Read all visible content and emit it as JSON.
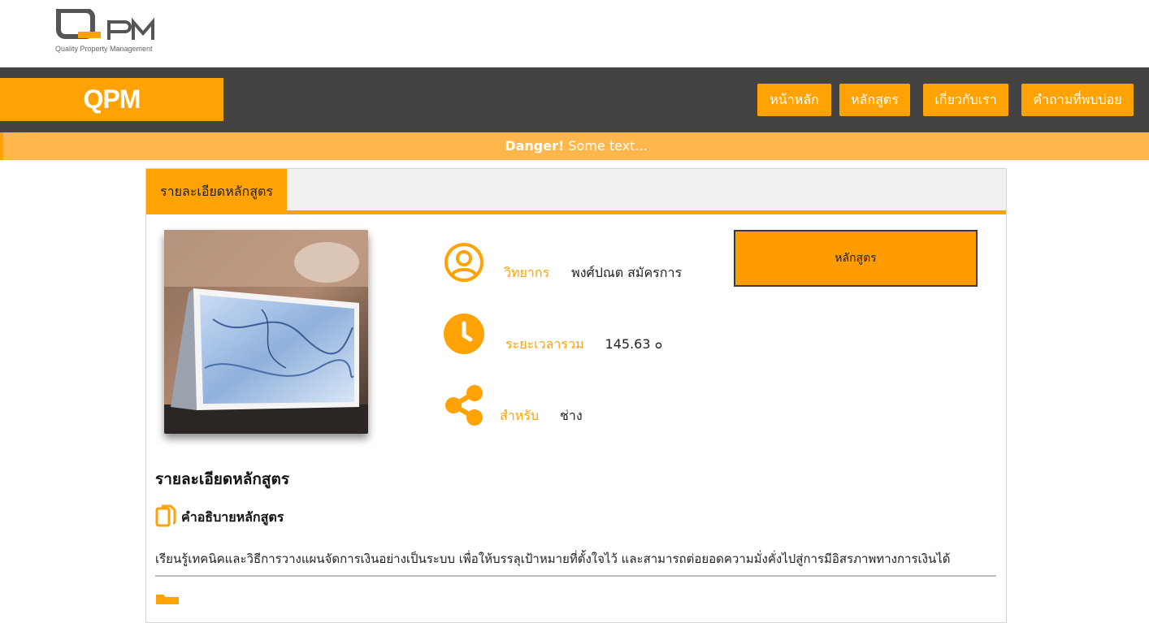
{
  "logo": {
    "letters": "QPM",
    "tagline": "Quality Property Management"
  },
  "navbar": {
    "brand": "QPM",
    "items": [
      {
        "label": "หน้าหลัก"
      },
      {
        "label": "หลักสูตร"
      },
      {
        "label": "เกี่ยวกับเรา"
      },
      {
        "label": "คำถามที่พบบ่อย"
      }
    ]
  },
  "alert": {
    "strong": "Danger!",
    "text": " Some text..."
  },
  "card": {
    "tab_label": "รายละเอียดหลักสูตร",
    "info": [
      {
        "icon": "user-circle-icon",
        "label": "วิทยากร",
        "value": "พงศ์ปณต สมัครการ"
      },
      {
        "icon": "clock-icon",
        "label": "ระยะเวลารวม",
        "value": "145.63 ๐"
      },
      {
        "icon": "share-icon",
        "label": "สำหรับ",
        "value": "ช่าง"
      }
    ],
    "course_button": "หลักสูตร",
    "section_heading": "รายละเอียดหลักสูตร",
    "description_heading": "คำอธิบายหลักสูตร",
    "description": "เรียนรู้เทคนิคและวิธีการวางแผนจัดการเงินอย่างเป็นระบบ เพื่อให้บรรลุเป้าหมายที่ตั้งใจไว้ และสามารถต่อยอดความมั่งคั่งไปสู่การมีอิสรภาพทางการเงินได้"
  },
  "colors": {
    "accent": "#ffa203",
    "nav_bg": "#434343",
    "alert_bg": "#ffb74b"
  }
}
